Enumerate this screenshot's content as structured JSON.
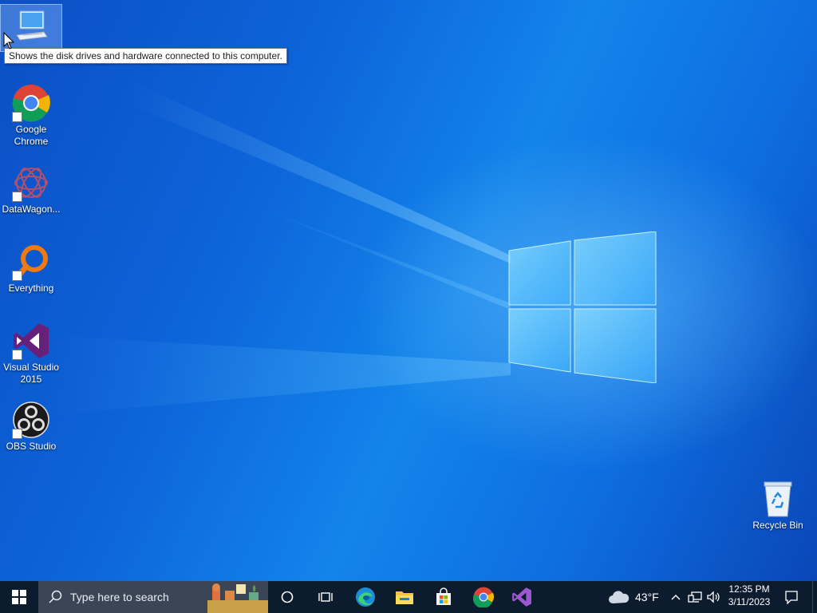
{
  "tooltip": {
    "text": "Shows the disk drives and hardware connected to this computer."
  },
  "desktop_icons": [
    {
      "name": "This PC",
      "label": ""
    },
    {
      "name": "Google Chrome",
      "label": "Google\nChrome"
    },
    {
      "name": "DataWagon",
      "label": "DataWagon..."
    },
    {
      "name": "Everything",
      "label": "Everything"
    },
    {
      "name": "Visual Studio 2015",
      "label": "Visual Studio\n2015"
    },
    {
      "name": "OBS Studio",
      "label": "OBS Studio"
    },
    {
      "name": "Recycle Bin",
      "label": "Recycle Bin"
    }
  ],
  "taskbar": {
    "search_placeholder": "Type here to search",
    "weather_temp": "43°F",
    "time": "12:35 PM",
    "date": "3/11/2023",
    "pinned_icons": [
      "cortana-icon",
      "task-view-icon",
      "edge-icon",
      "file-explorer-icon",
      "microsoft-store-icon",
      "chrome-icon",
      "visual-studio-icon"
    ]
  },
  "colors": {
    "taskbar": "#0d1b2e",
    "search_box": "#3a4656",
    "wallpaper_base": "#0d63d8"
  }
}
